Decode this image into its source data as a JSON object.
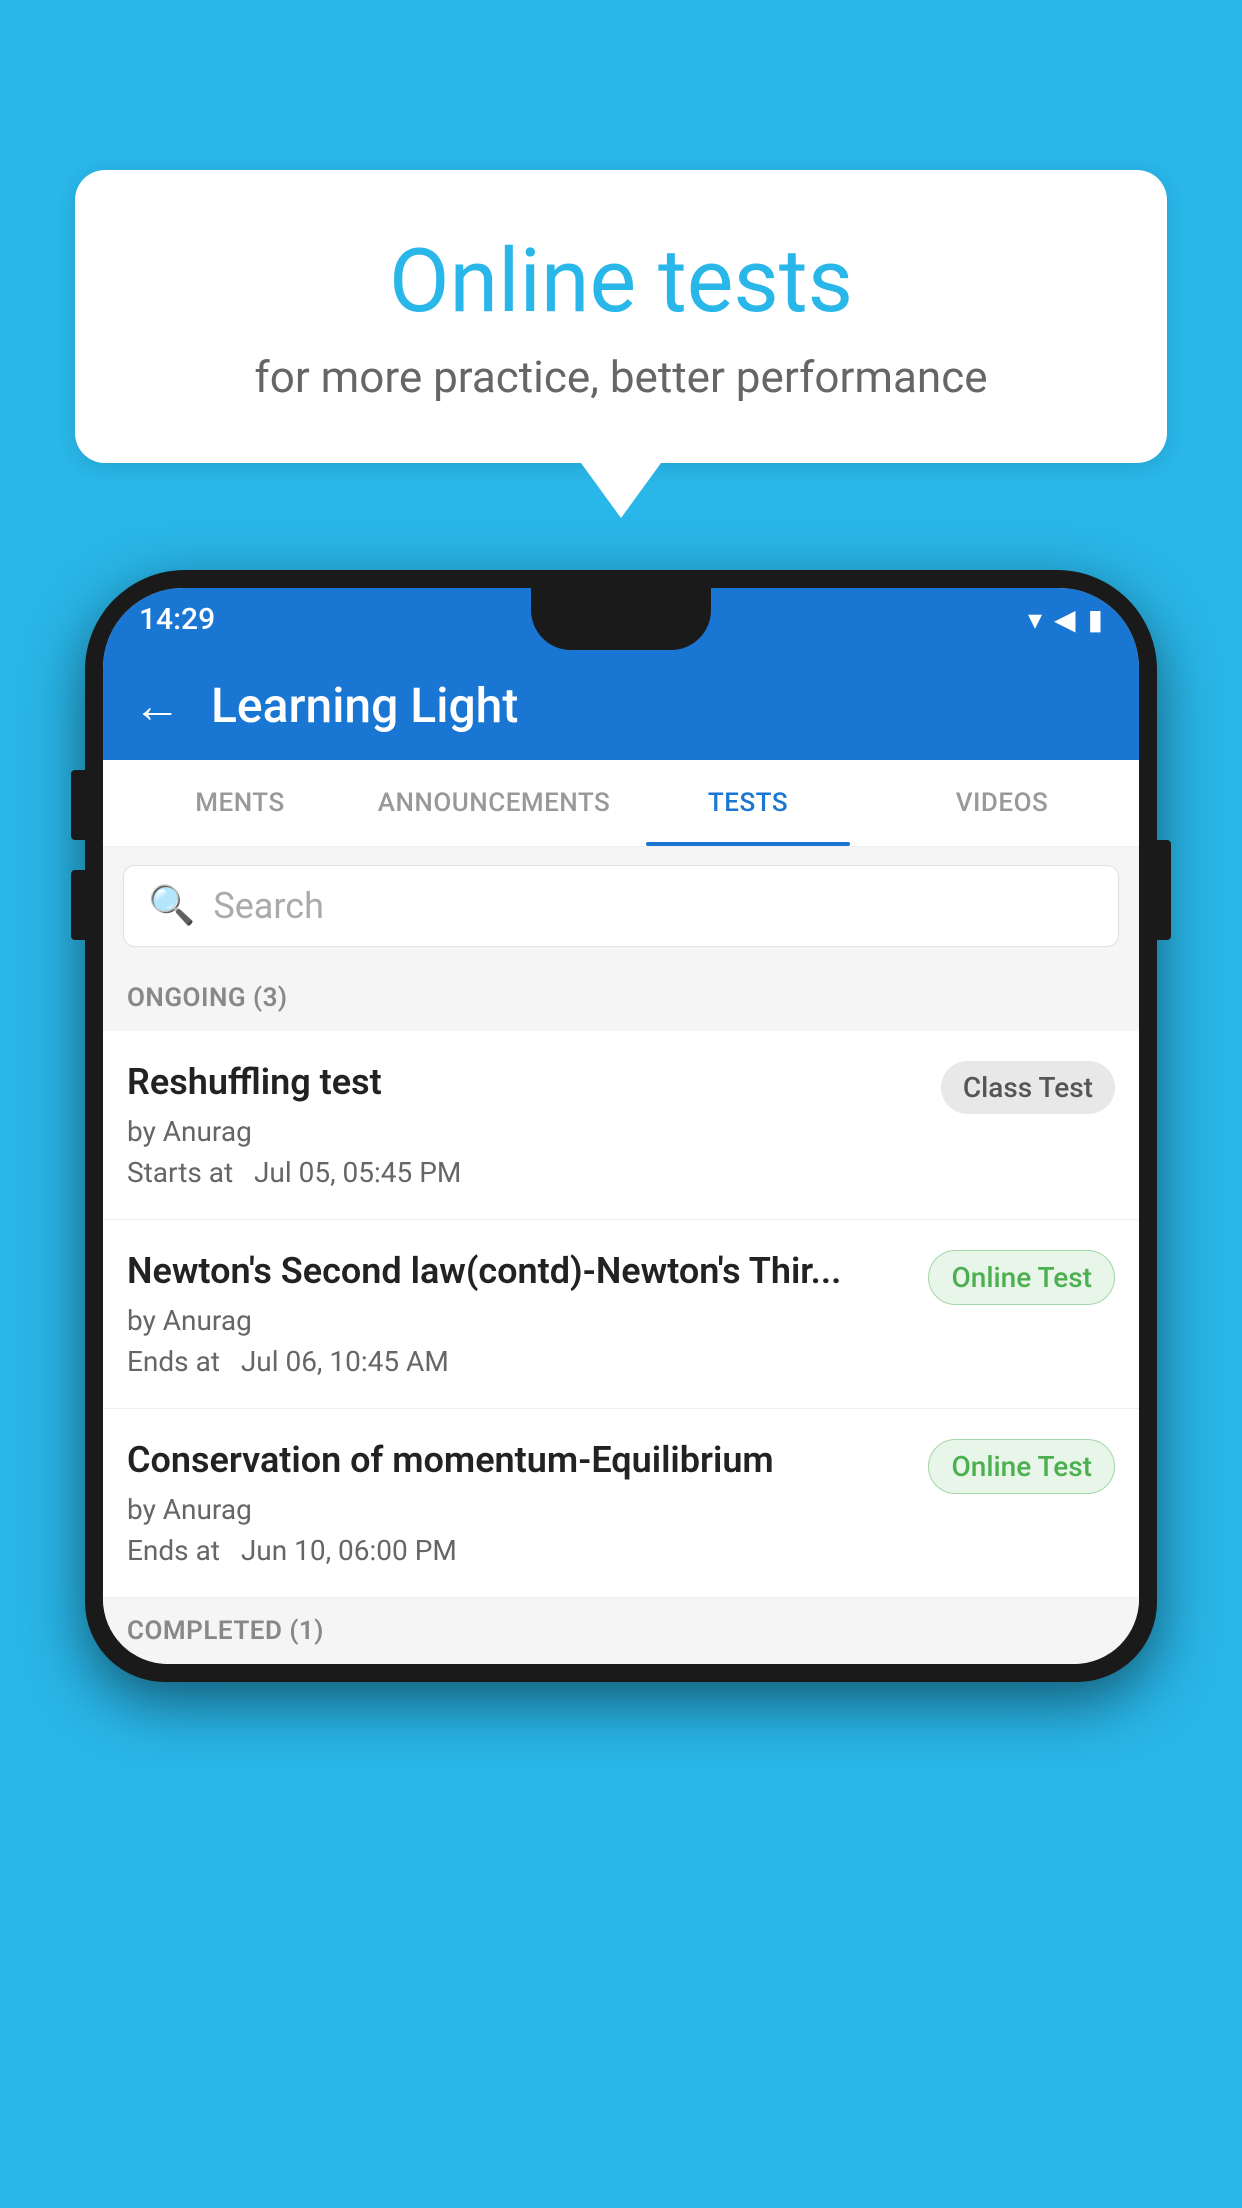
{
  "background_color": "#29b6e8",
  "speech_bubble": {
    "title": "Online tests",
    "subtitle": "for more practice, better performance"
  },
  "status_bar": {
    "time": "14:29",
    "wifi_icon": "▾",
    "signal_icon": "▲",
    "battery_icon": "▮"
  },
  "app_header": {
    "back_label": "←",
    "title": "Learning Light"
  },
  "tabs": [
    {
      "label": "MENTS",
      "active": false
    },
    {
      "label": "ANNOUNCEMENTS",
      "active": false
    },
    {
      "label": "TESTS",
      "active": true
    },
    {
      "label": "VIDEOS",
      "active": false
    }
  ],
  "search": {
    "placeholder": "Search"
  },
  "ongoing_section": {
    "label": "ONGOING (3)"
  },
  "tests": [
    {
      "name": "Reshuffling test",
      "by": "by Anurag",
      "time_label": "Starts at",
      "time": "Jul 05, 05:45 PM",
      "badge": "Class Test",
      "badge_type": "class"
    },
    {
      "name": "Newton's Second law(contd)-Newton's Thir...",
      "by": "by Anurag",
      "time_label": "Ends at",
      "time": "Jul 06, 10:45 AM",
      "badge": "Online Test",
      "badge_type": "online"
    },
    {
      "name": "Conservation of momentum-Equilibrium",
      "by": "by Anurag",
      "time_label": "Ends at",
      "time": "Jun 10, 06:00 PM",
      "badge": "Online Test",
      "badge_type": "online"
    }
  ],
  "completed_section": {
    "label": "COMPLETED (1)"
  }
}
